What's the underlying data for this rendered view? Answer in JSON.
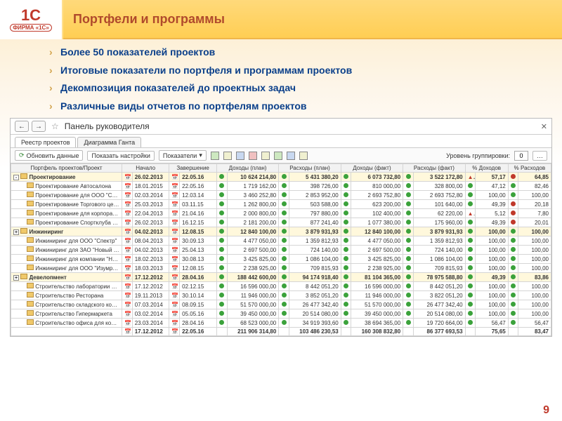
{
  "slide": {
    "title": "Портфели и программы",
    "logo_main": "1С",
    "logo_sub": "ФИРМА «1С»",
    "page_number": "9",
    "bullets": [
      "Более 50 показателей проектов",
      "Итоговые показатели по портфеля и программам проектов",
      "Декомпозиция показателей до проектных задач",
      "Различные виды отчетов по портфелям проектов"
    ]
  },
  "window": {
    "title": "Панель руководителя",
    "tabs": [
      "Реестр проектов",
      "Диаграмма Ганта"
    ],
    "toolbar": {
      "refresh": "Обновить данные",
      "show_settings": "Показать настройки",
      "dropdown": "Показатели",
      "grouping_label": "Уровень группировки:",
      "grouping_value": "0"
    },
    "columns": [
      "Портфель проектов/Проект",
      "Начало",
      "Завершение",
      "Доходы (план)",
      "Расходы (план)",
      "Доходы (факт)",
      "Расходы (факт)",
      "% Доходов",
      "% Расходов"
    ],
    "rows": [
      {
        "t": "g",
        "exp": "-",
        "name": "Проектирование",
        "d1": "26.02.2013",
        "d2": "22.05.16",
        "v1": "10 624 214,80",
        "v2": "5 431 380,20",
        "v3": "6 073 732,80",
        "v4": "3 522 172,80",
        "p1": "57,17",
        "p2": "64,85",
        "s1": "r",
        "s2": "r"
      },
      {
        "t": "r",
        "name": "Проектирование Автосалона",
        "d1": "18.01.2015",
        "d2": "22.05.16",
        "v1": "1 719 162,00",
        "v2": "398 726,00",
        "v3": "810 000,00",
        "v4": "328 800,00",
        "p1": "47,12",
        "p2": "82,46",
        "s1": "g",
        "s2": "g"
      },
      {
        "t": "r",
        "name": "Проектирование для ООО \"Стройкорпорац...",
        "d1": "02.03.2014",
        "d2": "12.03.14",
        "v1": "3 460 252,80",
        "v2": "2 853 952,00",
        "v3": "2 693 752,80",
        "v4": "2 693 752,80",
        "p1": "100,00",
        "p2": "100,00",
        "s1": "g",
        "s2": "g"
      },
      {
        "t": "r",
        "name": "Проектирование Торгового центра",
        "d1": "25.03.2013",
        "d2": "03.11.15",
        "v1": "1 262 800,00",
        "v2": "503 588,00",
        "v3": "623 200,00",
        "v4": "101 640,00",
        "p1": "49,39",
        "p2": "20,18",
        "s1": "g",
        "s2": "r"
      },
      {
        "t": "r",
        "name": "Проектирование для корпорации \"Надежн...",
        "d1": "22.04.2013",
        "d2": "21.04.16",
        "v1": "2 000 800,00",
        "v2": "797 880,00",
        "v3": "102 400,00",
        "v4": "62 220,00",
        "p1": "5,12",
        "p2": "7,80",
        "s1": "r",
        "s2": "r"
      },
      {
        "t": "r",
        "name": "Проектирование Спортклуба \"Аполлон\"",
        "d1": "26.02.2013",
        "d2": "16.12.15",
        "v1": "2 181 200,00",
        "v2": "877 241,40",
        "v3": "1 077 380,00",
        "v4": "175 960,00",
        "p1": "49,39",
        "p2": "20,01",
        "s1": "g",
        "s2": "r"
      },
      {
        "t": "g",
        "exp": "+",
        "name": "Инжиниринг",
        "d1": "04.02.2013",
        "d2": "12.08.15",
        "v1": "12 840 100,00",
        "v2": "3 879 931,93",
        "v3": "12 840 100,00",
        "v4": "3 879 931,93",
        "p1": "100,00",
        "p2": "100,00",
        "s1": "g",
        "s2": "g"
      },
      {
        "t": "r",
        "name": "Инжиниринг для ООО \"Спектр\"",
        "d1": "08.04.2013",
        "d2": "30.09.13",
        "v1": "4 477 050,00",
        "v2": "1 359 812,93",
        "v3": "4 477 050,00",
        "v4": "1 359 812,93",
        "p1": "100,00",
        "p2": "100,00",
        "s1": "g",
        "s2": "g"
      },
      {
        "t": "r",
        "name": "Инжиниринг для ЗАО \"Новый век\"",
        "d1": "04.02.2013",
        "d2": "25.04.13",
        "v1": "2 697 500,00",
        "v2": "724 140,00",
        "v3": "2 697 500,00",
        "v4": "724 140,00",
        "p1": "100,00",
        "p2": "100,00",
        "s1": "g",
        "s2": "g"
      },
      {
        "t": "r",
        "name": "Инжиниринг для компании \"Надежная кре...",
        "d1": "18.02.2013",
        "d2": "30.08.13",
        "v1": "3 425 825,00",
        "v2": "1 086 104,00",
        "v3": "3 425 825,00",
        "v4": "1 086 104,00",
        "p1": "100,00",
        "p2": "100,00",
        "s1": "g",
        "s2": "g"
      },
      {
        "t": "r",
        "name": "Инжиниринг для ООО \"Изумруд\"",
        "d1": "18.03.2013",
        "d2": "12.08.15",
        "v1": "2 238 925,00",
        "v2": "709 815,93",
        "v3": "2 238 925,00",
        "v4": "709 815,93",
        "p1": "100,00",
        "p2": "100,00",
        "s1": "g",
        "s2": "g"
      },
      {
        "t": "g",
        "exp": "+",
        "name": "Девелопмент",
        "d1": "17.12.2012",
        "d2": "28.04.16",
        "v1": "188 442 600,00",
        "v2": "94 174 918,40",
        "v3": "81 104 365,00",
        "v4": "78 975 588,80",
        "p1": "49,39",
        "p2": "83,86",
        "s1": "g",
        "s2": "g"
      },
      {
        "t": "r",
        "name": "Строительство лаборатории для ООО \"Спе...",
        "d1": "17.12.2012",
        "d2": "02.12.15",
        "v1": "16 596 000,00",
        "v2": "8 442 051,20",
        "v3": "16 596 000,00",
        "v4": "8 442 051,20",
        "p1": "100,00",
        "p2": "100,00",
        "s1": "g",
        "s2": "g"
      },
      {
        "t": "r",
        "name": "Строительство Ресторана",
        "d1": "19.11.2013",
        "d2": "30.10.14",
        "v1": "11 946 000,00",
        "v2": "3 852 051,20",
        "v3": "11 946 000,00",
        "v4": "3 822 051,20",
        "p1": "100,00",
        "p2": "100,00",
        "s1": "g",
        "s2": "g"
      },
      {
        "t": "r",
        "name": "Строительство складского комплекса для ...",
        "d1": "07.03.2014",
        "d2": "08.09.15",
        "v1": "51 570 000,00",
        "v2": "26 477 342,40",
        "v3": "51 570 000,00",
        "v4": "26 477 342,40",
        "p1": "100,00",
        "p2": "100,00",
        "s1": "g",
        "s2": "g"
      },
      {
        "t": "r",
        "name": "Строительство Гипермаркета",
        "d1": "03.02.2014",
        "d2": "05.05.16",
        "v1": "39 450 000,00",
        "v2": "20 514 080,00",
        "v3": "39 450 000,00",
        "v4": "20 514 080,00",
        "p1": "100,00",
        "p2": "100,00",
        "s1": "g",
        "s2": "g"
      },
      {
        "t": "r",
        "name": "Строительство офиса для корпорации \"Н...",
        "d1": "23.03.2014",
        "d2": "28.04.16",
        "v1": "68 523 000,00",
        "v2": "34 919 393,60",
        "v3": "38 694 365,00",
        "v4": "19 720 664,00",
        "p1": "56,47",
        "p2": "56,47",
        "s1": "g",
        "s2": "g"
      },
      {
        "t": "tot",
        "name": "",
        "d1": "17.12.2012",
        "d2": "22.05.16",
        "v1": "211 906 314,80",
        "v2": "103 486 230,53",
        "v3": "160 308 832,80",
        "v4": "86 377 693,53",
        "p1": "75,65",
        "p2": "83,47"
      }
    ]
  }
}
